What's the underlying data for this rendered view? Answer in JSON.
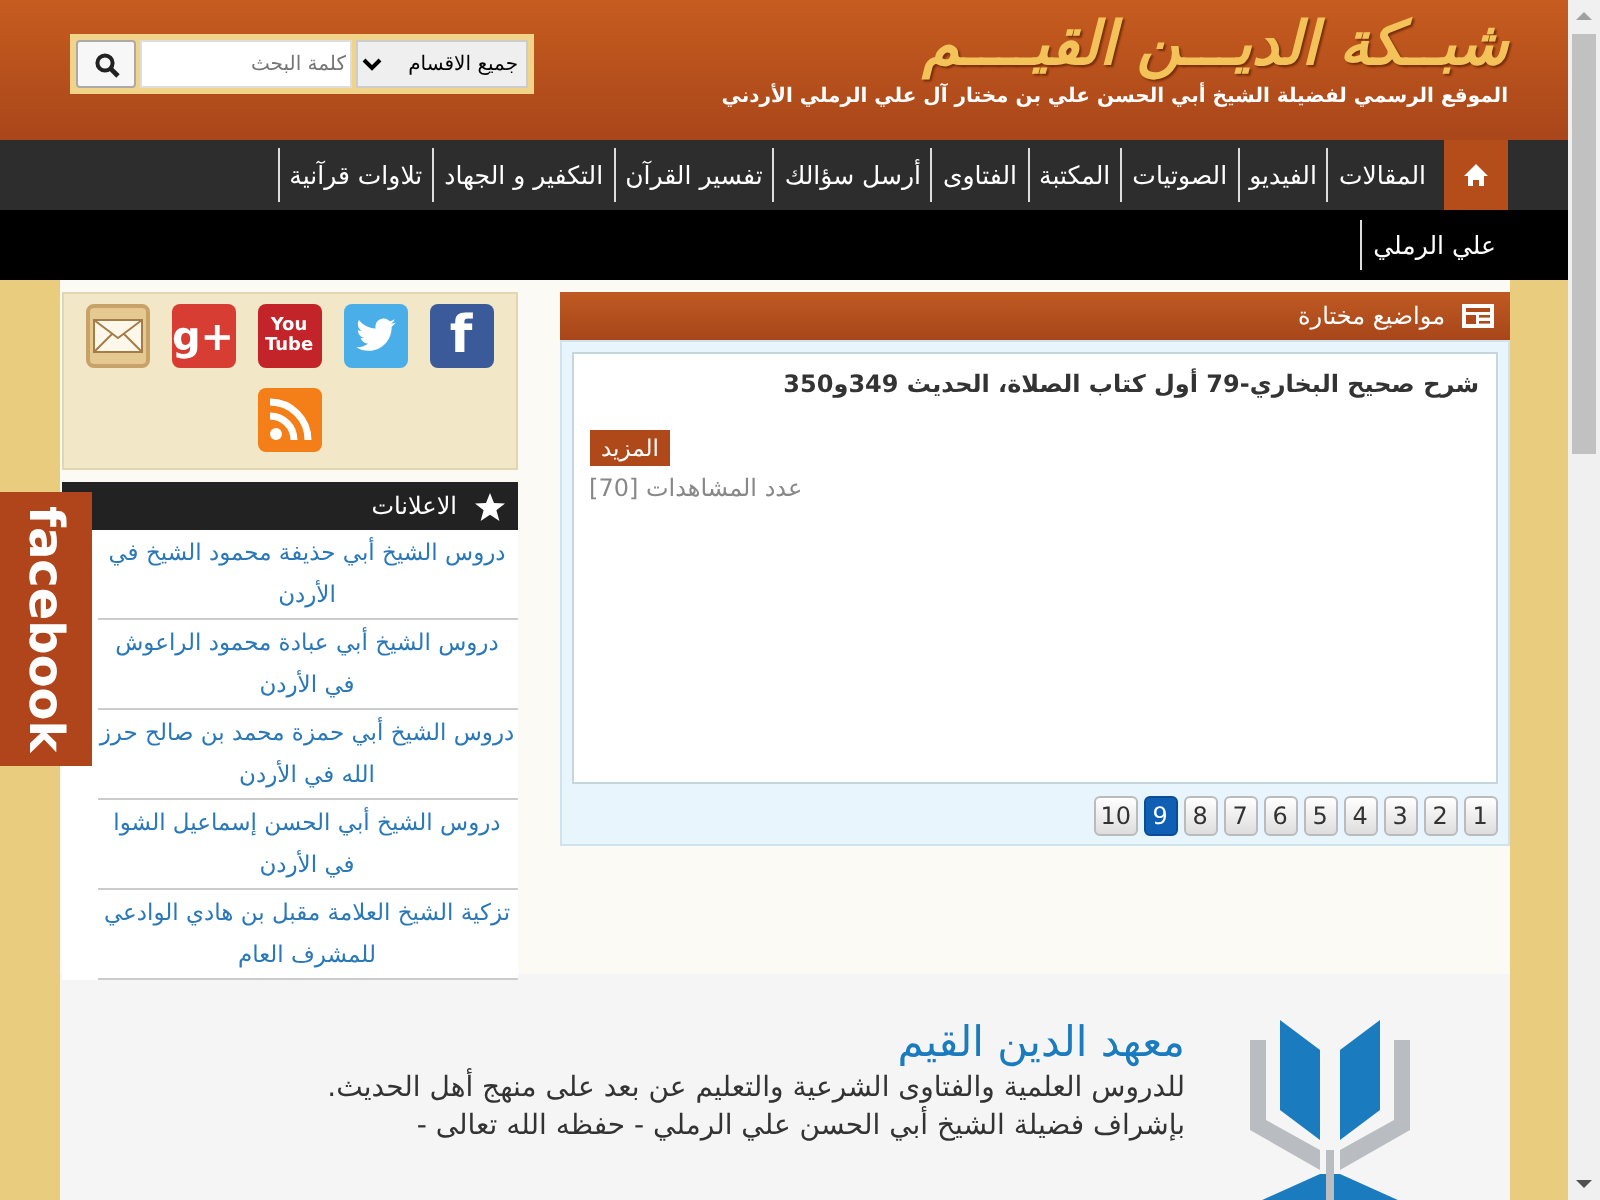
{
  "header": {
    "title": "شبــكة الديـــن القيــــم",
    "subtitle": "الموقع الرسمي لفضيلة الشيخ أبي الحسن علي بن مختار آل علي الرملي الأردني",
    "search": {
      "category": "جميع الاقسام",
      "placeholder": "كلمة البحث"
    }
  },
  "nav": [
    {
      "kind": "home",
      "selected": true
    },
    {
      "kind": "link",
      "label": "المقالات",
      "selected": false
    },
    {
      "kind": "link",
      "label": "الفيديو",
      "selected": false
    },
    {
      "kind": "link",
      "label": "الصوتيات",
      "selected": false
    },
    {
      "kind": "link",
      "label": "المكتبة",
      "selected": false
    },
    {
      "kind": "link",
      "label": "الفتاوى",
      "selected": false
    },
    {
      "kind": "link",
      "label": "أرسل سؤالك",
      "selected": false
    },
    {
      "kind": "link",
      "label": "تفسير القرآن",
      "selected": false
    },
    {
      "kind": "link",
      "label": "التكفير و الجهاد",
      "selected": false
    },
    {
      "kind": "link",
      "label": "تلاوات قرآنية",
      "selected": false
    }
  ],
  "subnav": [
    "علي الرملي"
  ],
  "featured": {
    "title": "مواضيع مختارة",
    "article": {
      "title": "شرح صحيح البخاري-79 أول كتاب الصلاة، الحديث 349و350",
      "more": "المزيد",
      "views": "عدد المشاهدات [70]"
    },
    "pages": [
      {
        "label": "1",
        "selected": false
      },
      {
        "label": "2",
        "selected": false
      },
      {
        "label": "3",
        "selected": false
      },
      {
        "label": "4",
        "selected": false
      },
      {
        "label": "5",
        "selected": false
      },
      {
        "label": "6",
        "selected": false
      },
      {
        "label": "7",
        "selected": false
      },
      {
        "label": "8",
        "selected": false
      },
      {
        "label": "9",
        "selected": true
      },
      {
        "label": "10",
        "selected": false
      }
    ]
  },
  "social": [
    {
      "kind": "facebook",
      "glyph": "f"
    },
    {
      "kind": "twitter"
    },
    {
      "kind": "youtube",
      "glyph": "You Tube"
    },
    {
      "kind": "googleplus",
      "glyph": "g+"
    },
    {
      "kind": "mail"
    },
    {
      "kind": "rss"
    }
  ],
  "ads": {
    "title": "الاعلانات",
    "items": [
      "دروس الشيخ أبي حذيفة محمود الشيخ في الأردن",
      "دروس الشيخ أبي عبادة محمود الراعوش في الأردن",
      "دروس الشيخ أبي حمزة محمد بن صالح حرز الله في الأردن",
      "دروس الشيخ أبي الحسن إسماعيل الشوا في الأردن",
      "تزكية الشيخ العلامة مقبل بن هادي الوادعي للمشرف العام"
    ]
  },
  "facebook_tab": "facebook",
  "banner": {
    "title": "معهد الدين القيم",
    "lines": [
      "للدروس العلمية والفتاوى الشرعية والتعليم عن بعد على منهج أهل الحديث.",
      "بإشراف فضيلة الشيخ أبي الحسن علي الرملي - حفظه الله تعالى -"
    ]
  }
}
